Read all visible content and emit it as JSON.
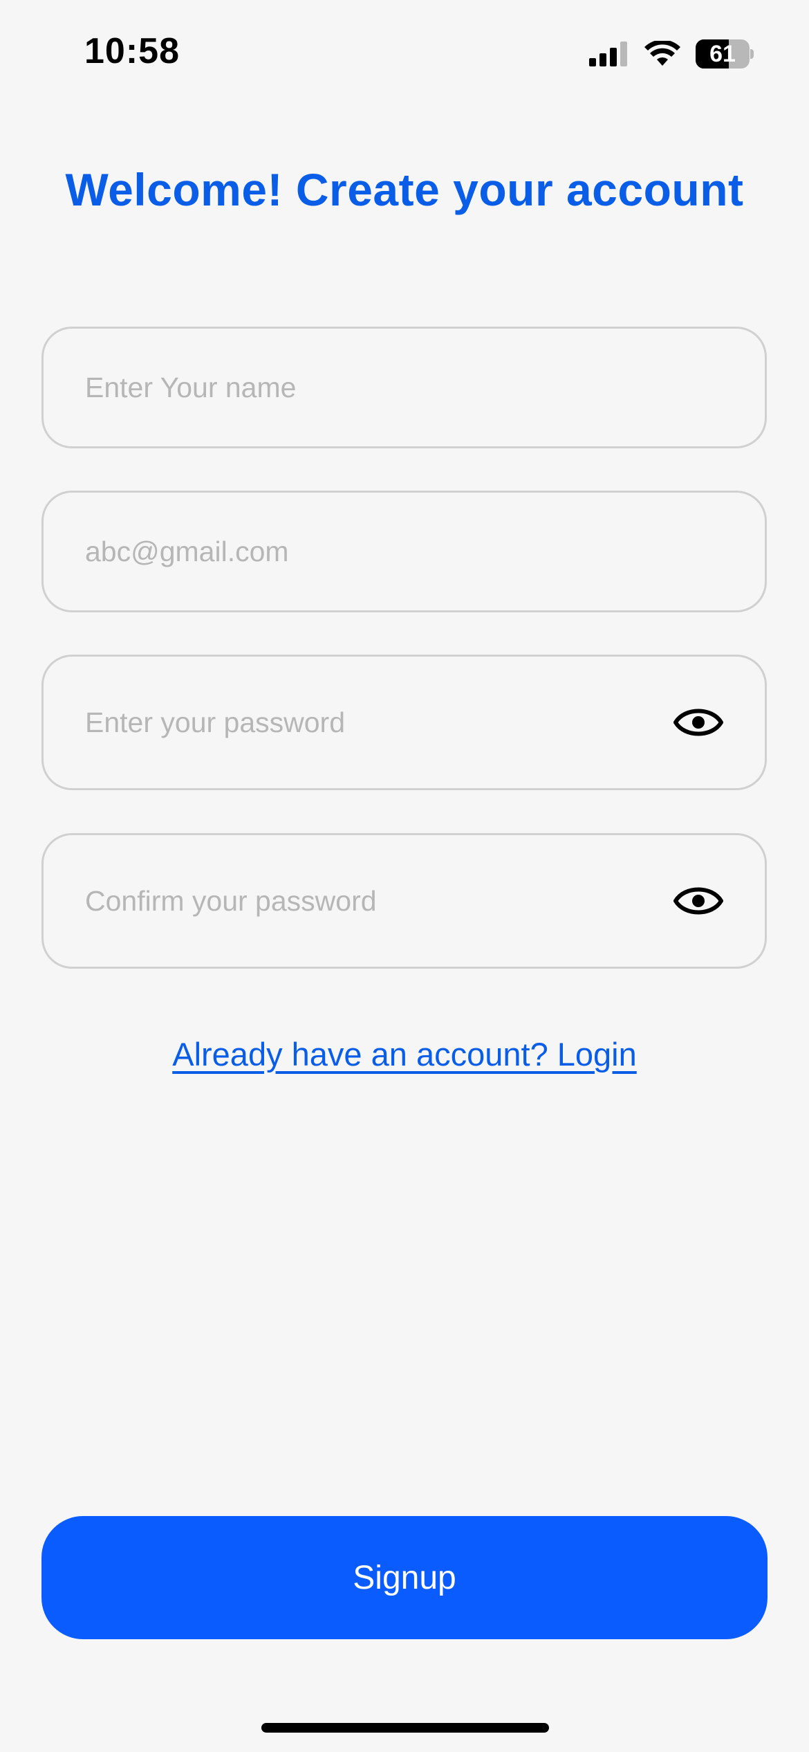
{
  "status_bar": {
    "time": "10:58",
    "battery_level": "61",
    "battery_fraction": 0.61,
    "icons": [
      "signal-icon",
      "wifi-icon",
      "battery-icon"
    ]
  },
  "title": "Welcome! Create your account",
  "fields": {
    "name": {
      "placeholder": "Enter Your name",
      "value": ""
    },
    "email": {
      "placeholder": "abc@gmail.com",
      "value": ""
    },
    "password": {
      "placeholder": "Enter your password",
      "value": ""
    },
    "confirm_password": {
      "placeholder": "Confirm your password",
      "value": ""
    }
  },
  "login_link": "Already have an account? Login",
  "signup_label": "Signup",
  "colors": {
    "accent": "#0a5de6",
    "button": "#0a5cff",
    "background": "#f6f6f6",
    "field_border": "#d0d0d0",
    "placeholder": "#b6b6b6"
  }
}
